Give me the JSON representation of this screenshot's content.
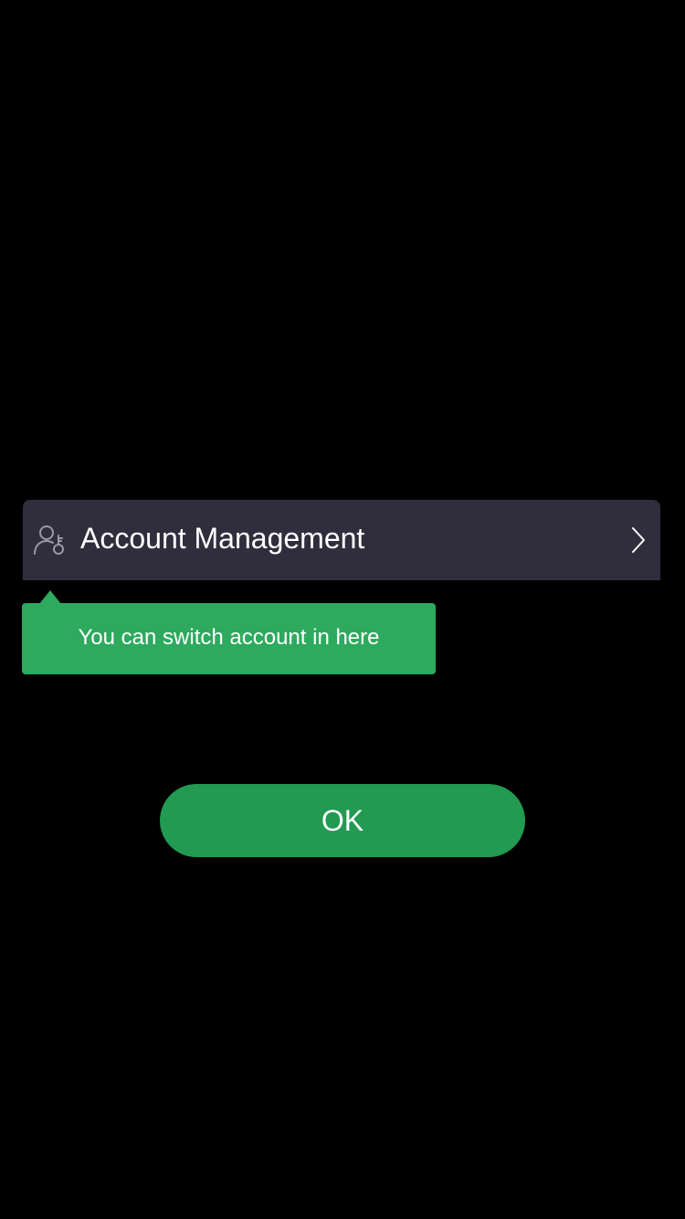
{
  "account_row": {
    "label": "Account Management",
    "icon": "account-key-icon",
    "chevron_icon": "chevron-right-icon",
    "background": "#302e3c"
  },
  "tooltip": {
    "text": "You can switch account in here",
    "background": "#2eaa5e"
  },
  "ok_button": {
    "label": "OK",
    "background": "#229a52"
  },
  "colors": {
    "overlay": "#000000",
    "text": "#ffffff",
    "icon": "#9a98a4"
  }
}
